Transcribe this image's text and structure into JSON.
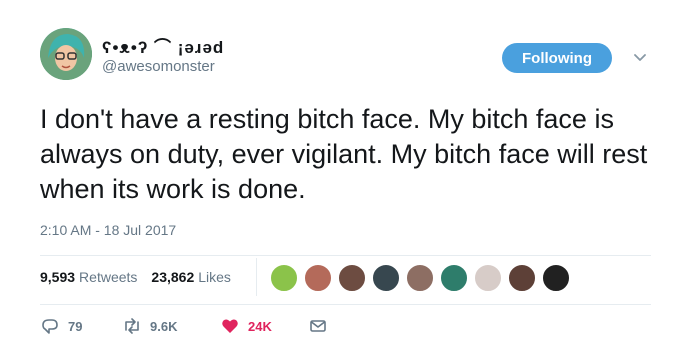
{
  "user": {
    "display_name": "ʕ•ᴥ•ʔ ⌒ ¡ǝɹǝd",
    "handle": "@awesomonster"
  },
  "follow_button": {
    "label": "Following"
  },
  "tweet": {
    "text": "I don't have a resting bitch face. My bitch face is always on duty, ever vigilant. My bitch face will rest when its work is done.",
    "timestamp": "2:10 AM - 18 Jul 2017"
  },
  "stats": {
    "retweets_count": "9,593",
    "retweets_label": "Retweets",
    "likes_count": "23,862",
    "likes_label": "Likes"
  },
  "likers": [
    {
      "name": "liker-1",
      "color": "#8bc34a"
    },
    {
      "name": "liker-2",
      "color": "#b46a5a"
    },
    {
      "name": "liker-3",
      "color": "#6d4c41"
    },
    {
      "name": "liker-4",
      "color": "#37474f"
    },
    {
      "name": "liker-5",
      "color": "#8d6e63"
    },
    {
      "name": "liker-6",
      "color": "#2e7d6b"
    },
    {
      "name": "liker-7",
      "color": "#d7ccc8"
    },
    {
      "name": "liker-8",
      "color": "#5d4037"
    },
    {
      "name": "liker-9",
      "color": "#212121"
    }
  ],
  "actions": {
    "reply_count": "79",
    "retweet_count": "9.6K",
    "like_count": "24K"
  },
  "colors": {
    "accent": "#4aa0de",
    "like_red": "#e0245e",
    "muted": "#657786"
  },
  "icons": [
    "chevron-down-icon",
    "reply-icon",
    "retweet-icon",
    "heart-icon",
    "message-icon"
  ]
}
